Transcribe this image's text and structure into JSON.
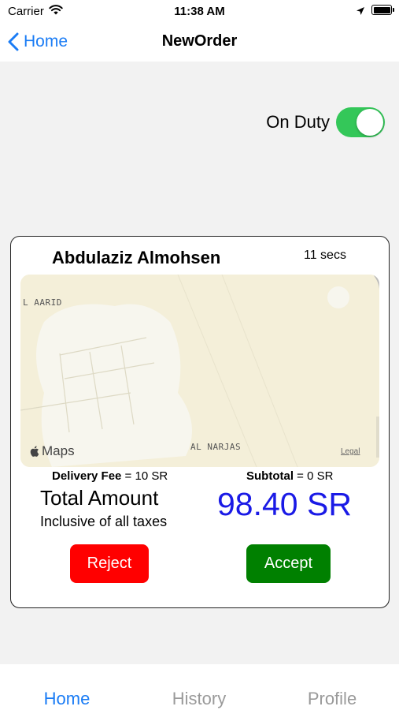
{
  "status_bar": {
    "carrier": "Carrier",
    "time": "11:38 AM"
  },
  "nav": {
    "back_label": "Home",
    "title": "NewOrder"
  },
  "duty": {
    "label": "On Duty",
    "on": true
  },
  "order": {
    "customer_name": "Abdulaziz Almohsen",
    "elapsed": "11 secs",
    "map": {
      "area_labels": [
        "L AARID",
        "AL NARJAS"
      ],
      "brand": "Maps",
      "legal": "Legal"
    },
    "delivery_fee_label": "Delivery Fee",
    "delivery_fee_value": " = 10 SR",
    "subtotal_label": "Subtotal",
    "subtotal_value": " = 0 SR",
    "total_label": "Total Amount",
    "total_note": "Inclusive of all taxes",
    "total_value": "98.40 SR",
    "reject_label": "Reject",
    "accept_label": "Accept"
  },
  "tabs": [
    {
      "label": "Home",
      "active": true
    },
    {
      "label": "History",
      "active": false
    },
    {
      "label": "Profile",
      "active": false
    }
  ],
  "colors": {
    "accent": "#1a7cf5",
    "toggle_on": "#34c759",
    "reject": "#ff0000",
    "accept": "#008000",
    "total": "#1a1ae6"
  }
}
